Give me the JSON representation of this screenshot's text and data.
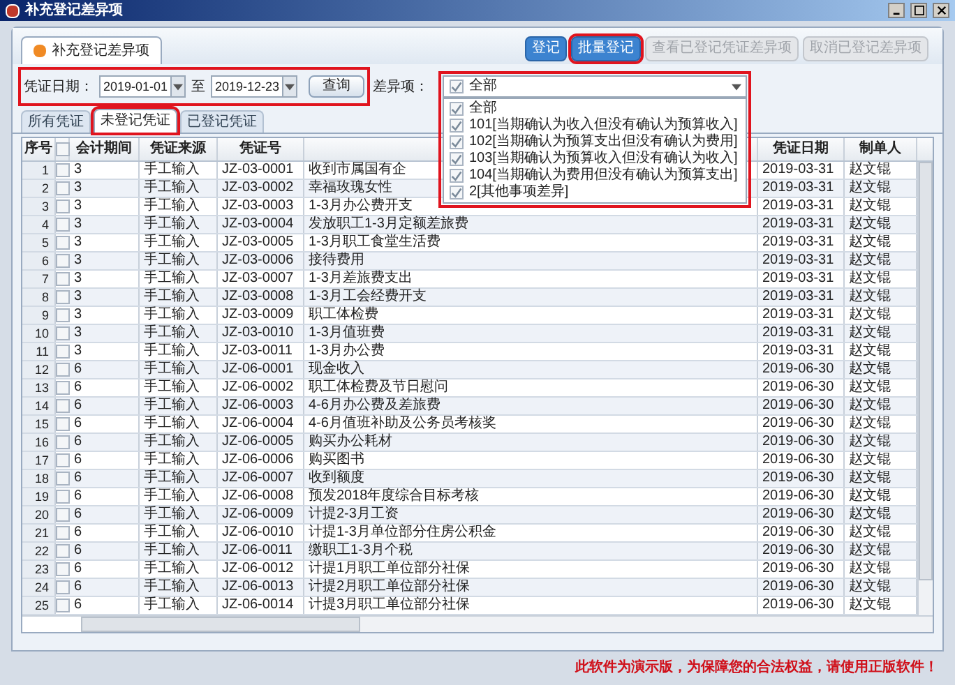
{
  "window": {
    "title": "补充登记差异项"
  },
  "panel_tab": {
    "label": "补充登记差异项"
  },
  "toolbar": [
    {
      "label": "登记",
      "disabled": false,
      "highlighted": false
    },
    {
      "label": "批量登记",
      "disabled": false,
      "highlighted": true
    },
    {
      "label": "查看已登记凭证差异项",
      "disabled": true,
      "highlighted": false
    },
    {
      "label": "取消已登记差异项",
      "disabled": true,
      "highlighted": false
    }
  ],
  "filter": {
    "highlighted": true,
    "date_label": "凭证日期：",
    "from": "2019-01-01",
    "to_label": "至",
    "to": "2019-12-23",
    "query_button": "查询"
  },
  "diff": {
    "label": "差异项：",
    "value": "全部",
    "checked": true,
    "highlighted": true,
    "expanded": true,
    "options": [
      {
        "label": "全部",
        "checked": true
      },
      {
        "label": "101[当期确认为收入但没有确认为预算收入]",
        "checked": true
      },
      {
        "label": "102[当期确认为预算支出但没有确认为费用]",
        "checked": true
      },
      {
        "label": "103[当期确认为预算收入但没有确认为收入]",
        "checked": true
      },
      {
        "label": "104[当期确认为费用但没有确认为预算支出]",
        "checked": true
      },
      {
        "label": "2[其他事项差异]",
        "checked": true
      }
    ]
  },
  "tabs": [
    {
      "label": "所有凭证",
      "selected": false,
      "highlighted": false
    },
    {
      "label": "未登记凭证",
      "selected": true,
      "highlighted": true
    },
    {
      "label": "已登记凭证",
      "selected": false,
      "highlighted": false
    }
  ],
  "table": {
    "columns": [
      "序号",
      "会计期间",
      "凭证来源",
      "凭证号",
      "凭证日期",
      "制单人"
    ],
    "all_checked": false,
    "rows": [
      {
        "no": "1",
        "checked": false,
        "period": "3",
        "source": "手工输入",
        "voucher": "JZ-03-0001",
        "summary": "收到市属国有企",
        "date": "2019-03-31",
        "creator": "赵文锟"
      },
      {
        "no": "2",
        "checked": false,
        "period": "3",
        "source": "手工输入",
        "voucher": "JZ-03-0002",
        "summary": "幸福玫瑰女性",
        "date": "2019-03-31",
        "creator": "赵文锟"
      },
      {
        "no": "3",
        "checked": false,
        "period": "3",
        "source": "手工输入",
        "voucher": "JZ-03-0003",
        "summary": "1-3月办公费开支",
        "date": "2019-03-31",
        "creator": "赵文锟"
      },
      {
        "no": "4",
        "checked": false,
        "period": "3",
        "source": "手工输入",
        "voucher": "JZ-03-0004",
        "summary": "发放职工1-3月定额差旅费",
        "date": "2019-03-31",
        "creator": "赵文锟"
      },
      {
        "no": "5",
        "checked": false,
        "period": "3",
        "source": "手工输入",
        "voucher": "JZ-03-0005",
        "summary": "1-3月职工食堂生活费",
        "date": "2019-03-31",
        "creator": "赵文锟"
      },
      {
        "no": "6",
        "checked": false,
        "period": "3",
        "source": "手工输入",
        "voucher": "JZ-03-0006",
        "summary": "接待费用",
        "date": "2019-03-31",
        "creator": "赵文锟"
      },
      {
        "no": "7",
        "checked": false,
        "period": "3",
        "source": "手工输入",
        "voucher": "JZ-03-0007",
        "summary": "1-3月差旅费支出",
        "date": "2019-03-31",
        "creator": "赵文锟"
      },
      {
        "no": "8",
        "checked": false,
        "period": "3",
        "source": "手工输入",
        "voucher": "JZ-03-0008",
        "summary": "1-3月工会经费开支",
        "date": "2019-03-31",
        "creator": "赵文锟"
      },
      {
        "no": "9",
        "checked": false,
        "period": "3",
        "source": "手工输入",
        "voucher": "JZ-03-0009",
        "summary": "职工体检费",
        "date": "2019-03-31",
        "creator": "赵文锟"
      },
      {
        "no": "10",
        "checked": false,
        "period": "3",
        "source": "手工输入",
        "voucher": "JZ-03-0010",
        "summary": "1-3月值班费",
        "date": "2019-03-31",
        "creator": "赵文锟"
      },
      {
        "no": "11",
        "checked": false,
        "period": "3",
        "source": "手工输入",
        "voucher": "JZ-03-0011",
        "summary": "1-3月办公费",
        "date": "2019-03-31",
        "creator": "赵文锟"
      },
      {
        "no": "12",
        "checked": false,
        "period": "6",
        "source": "手工输入",
        "voucher": "JZ-06-0001",
        "summary": "现金收入",
        "date": "2019-06-30",
        "creator": "赵文锟"
      },
      {
        "no": "13",
        "checked": false,
        "period": "6",
        "source": "手工输入",
        "voucher": "JZ-06-0002",
        "summary": "职工体检费及节日慰问",
        "date": "2019-06-30",
        "creator": "赵文锟"
      },
      {
        "no": "14",
        "checked": false,
        "period": "6",
        "source": "手工输入",
        "voucher": "JZ-06-0003",
        "summary": "4-6月办公费及差旅费",
        "date": "2019-06-30",
        "creator": "赵文锟"
      },
      {
        "no": "15",
        "checked": false,
        "period": "6",
        "source": "手工输入",
        "voucher": "JZ-06-0004",
        "summary": "4-6月值班补助及公务员考核奖",
        "date": "2019-06-30",
        "creator": "赵文锟"
      },
      {
        "no": "16",
        "checked": false,
        "period": "6",
        "source": "手工输入",
        "voucher": "JZ-06-0005",
        "summary": "购买办公耗材",
        "date": "2019-06-30",
        "creator": "赵文锟"
      },
      {
        "no": "17",
        "checked": false,
        "period": "6",
        "source": "手工输入",
        "voucher": "JZ-06-0006",
        "summary": "购买图书",
        "date": "2019-06-30",
        "creator": "赵文锟"
      },
      {
        "no": "18",
        "checked": false,
        "period": "6",
        "source": "手工输入",
        "voucher": "JZ-06-0007",
        "summary": "收到额度",
        "date": "2019-06-30",
        "creator": "赵文锟"
      },
      {
        "no": "19",
        "checked": false,
        "period": "6",
        "source": "手工输入",
        "voucher": "JZ-06-0008",
        "summary": "预发2018年度综合目标考核",
        "date": "2019-06-30",
        "creator": "赵文锟"
      },
      {
        "no": "20",
        "checked": false,
        "period": "6",
        "source": "手工输入",
        "voucher": "JZ-06-0009",
        "summary": "计提2-3月工资",
        "date": "2019-06-30",
        "creator": "赵文锟"
      },
      {
        "no": "21",
        "checked": false,
        "period": "6",
        "source": "手工输入",
        "voucher": "JZ-06-0010",
        "summary": "计提1-3月单位部分住房公积金",
        "date": "2019-06-30",
        "creator": "赵文锟"
      },
      {
        "no": "22",
        "checked": false,
        "period": "6",
        "source": "手工输入",
        "voucher": "JZ-06-0011",
        "summary": "缴职工1-3月个税",
        "date": "2019-06-30",
        "creator": "赵文锟"
      },
      {
        "no": "23",
        "checked": false,
        "period": "6",
        "source": "手工输入",
        "voucher": "JZ-06-0012",
        "summary": "计提1月职工单位部分社保",
        "date": "2019-06-30",
        "creator": "赵文锟"
      },
      {
        "no": "24",
        "checked": false,
        "period": "6",
        "source": "手工输入",
        "voucher": "JZ-06-0013",
        "summary": "计提2月职工单位部分社保",
        "date": "2019-06-30",
        "creator": "赵文锟"
      },
      {
        "no": "25",
        "checked": false,
        "period": "6",
        "source": "手工输入",
        "voucher": "JZ-06-0014",
        "summary": "计提3月职工单位部分社保",
        "date": "2019-06-30",
        "creator": "赵文锟"
      }
    ]
  },
  "status_bar": {
    "notice": "此软件为演示版，为保障您的合法权益，请使用正版软件！"
  }
}
